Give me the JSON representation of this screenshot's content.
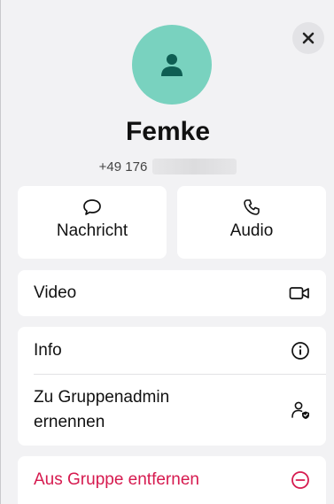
{
  "contact": {
    "name": "Femke",
    "phone_prefix": "+49 176"
  },
  "actions": {
    "message_label": "Nachricht",
    "audio_label": "Audio"
  },
  "rows": {
    "video_label": "Video",
    "info_label": "Info",
    "make_admin_line1": "Zu Gruppenadmin",
    "make_admin_line2": "ernennen",
    "remove_label": "Aus Gruppe entfernen"
  },
  "colors": {
    "avatar_bg": "#79d2bf",
    "avatar_icon": "#0e5e53",
    "danger": "#d61a4f",
    "background": "#f2f2f4"
  },
  "icons": {
    "close": "close-icon",
    "avatar": "person-icon",
    "message": "speech-bubble-icon",
    "audio": "phone-icon",
    "video": "video-camera-icon",
    "info": "info-circle-icon",
    "admin": "person-shield-icon",
    "remove": "minus-circle-icon"
  }
}
